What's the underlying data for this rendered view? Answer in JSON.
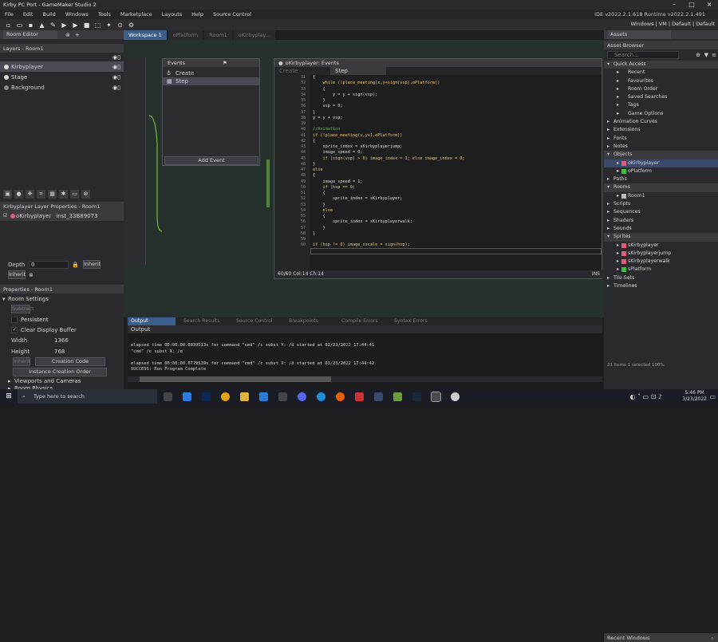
{
  "window": {
    "title": "Kirby PC Port - GameMaker Studio 2"
  },
  "menu": [
    "File",
    "Edit",
    "Build",
    "Windows",
    "Tools",
    "Marketplace",
    "Layouts",
    "Help",
    "Source Control"
  ],
  "version": "IDE v2022.2.1.618  Runtime v2022.2.1.491",
  "toolbar_right": "Windows | VM | Default | Default",
  "left": {
    "tab": "Room Editor",
    "layers_title": "Layers - Room1",
    "layers": [
      "Kirbyplayer",
      "Stage",
      "Background"
    ],
    "layer_props_title": "Kirbyplayer Layer Properties - Room1",
    "instance_obj": "oKirbyplayer",
    "instance_id": "inst_33B89073",
    "depth_label": "Depth",
    "depth_value": "0",
    "inherit": "Inherit",
    "props_title": "Properties - Room1",
    "room_settings": "Room Settings",
    "subtract": "Subtract",
    "persistent": "Persistent",
    "clear_display": "Clear Display Buffer",
    "width_label": "Width",
    "width_value": "1366",
    "height_label": "Height",
    "height_value": "768",
    "creation_code": "Creation Code",
    "instance_order": "Instance Creation Order",
    "viewports": "Viewports and Cameras",
    "physics": "Room Physics"
  },
  "canvas_tabs": [
    "Workspace 1",
    "oPlatform",
    "Room1",
    "oKirbyplay..."
  ],
  "events": {
    "title": "Events",
    "items": [
      "Create",
      "Step"
    ],
    "add": "Add Event"
  },
  "code": {
    "title": "oKirbyplayer: Events",
    "tabs": [
      "Create",
      "Step"
    ],
    "lines": [
      "{",
      "    while (!place_meeting(x,y+sign(vsp),oPlatform))",
      "    {",
      "        y = y + sign(vsp);",
      "    }",
      "    vsp = 0;",
      "}",
      "y = y + vsp;",
      "",
      "//Animation",
      "if (!place_meeting(x,y+1,oPlatform))",
      "{",
      "    sprite_index = sKirbyplayerjump;",
      "    image_speed = 0;",
      "    if (sign(vsp) > 0) image_index = 1; else image_index = 0;",
      "}",
      "else",
      "{",
      "    image_speed = 1;",
      "    if (hsp == 0)",
      "    {",
      "        sprite_index = sKirbyplayer;",
      "    }",
      "    else",
      "    {",
      "        sprite_index = sKirbyplayerwalk;",
      "    }",
      "}",
      "",
      "if (hsp != 0) image_xscale = sign(hsp);"
    ],
    "status": "60/60 Col:14 Ch:14",
    "ins": "INS"
  },
  "output": {
    "tabs": [
      "Output",
      "Search Results",
      "Source Control",
      "Breakpoints",
      "Compile Errors",
      "Syntax Errors"
    ],
    "header": "Output",
    "lines": [
      "elapsed time 00:00:00.0839513s for command \"cmd\" /c subst Y: /d started at 03/23/2022 17:44:41",
      "\"cmd\" /c subst X: /d",
      "",
      "elapsed time 00:00:00.0779539s for command \"cmd\" /c subst X: /d started at 03/23/2022 17:44:42",
      "SUCCESS: Run Program Complete"
    ]
  },
  "assets": {
    "tab": "Assets",
    "browser": "Asset Browser",
    "search": "Search...",
    "items": [
      {
        "t": "Quick Access",
        "d": 0,
        "h": 1
      },
      {
        "t": "Recent",
        "d": 1
      },
      {
        "t": "Favourites",
        "d": 1
      },
      {
        "t": "Room Order",
        "d": 1
      },
      {
        "t": "Saved Searches",
        "d": 1
      },
      {
        "t": "Tags",
        "d": 1
      },
      {
        "t": "Game Options",
        "d": 1
      },
      {
        "t": "Animation Curves",
        "d": 0
      },
      {
        "t": "Extensions",
        "d": 0
      },
      {
        "t": "Fonts",
        "d": 0
      },
      {
        "t": "Notes",
        "d": 0
      },
      {
        "t": "Objects",
        "d": 0,
        "h": 1
      },
      {
        "t": "oKirbyplayer",
        "d": 1,
        "s": 1
      },
      {
        "t": "oPlatform",
        "d": 1
      },
      {
        "t": "Paths",
        "d": 0
      },
      {
        "t": "Rooms",
        "d": 0,
        "h": 1
      },
      {
        "t": "Room1",
        "d": 1
      },
      {
        "t": "Scripts",
        "d": 0
      },
      {
        "t": "Sequences",
        "d": 0
      },
      {
        "t": "Shaders",
        "d": 0
      },
      {
        "t": "Sounds",
        "d": 0
      },
      {
        "t": "Sprites",
        "d": 0,
        "h": 1
      },
      {
        "t": "sKirbyplayer",
        "d": 1
      },
      {
        "t": "sKirbyplayerjump",
        "d": 1
      },
      {
        "t": "sKirbyplayerwalk",
        "d": 1
      },
      {
        "t": "sPlatform",
        "d": 1
      },
      {
        "t": "Tile Sets",
        "d": 0
      },
      {
        "t": "Timelines",
        "d": 0
      }
    ],
    "footer": "21 items      1 selected       100%",
    "recent": "Recent Windows"
  },
  "taskbar": {
    "search": "Type here to search",
    "time": "5:46 PM",
    "date": "3/23/2022"
  }
}
